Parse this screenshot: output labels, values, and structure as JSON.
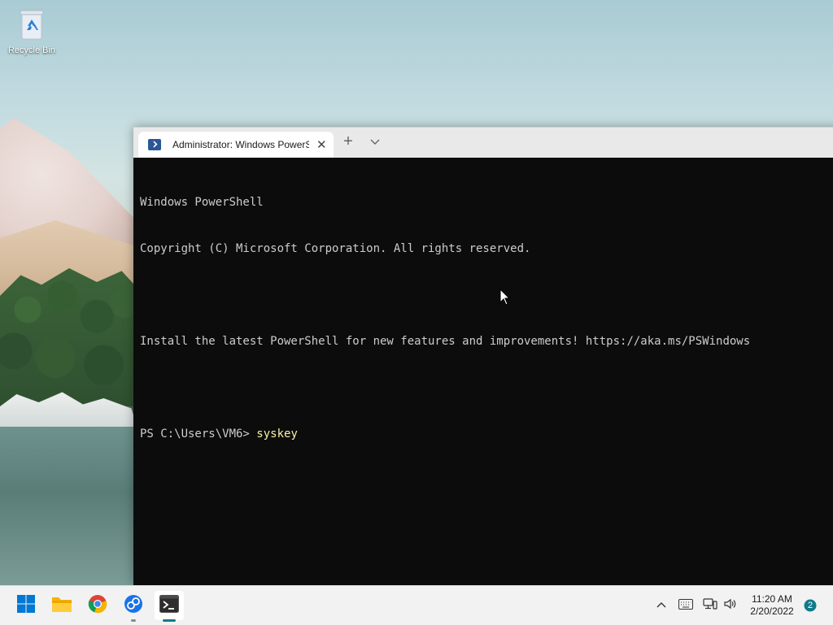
{
  "desktop": {
    "icons": [
      {
        "label": "Recycle Bin",
        "icon": "recycle-bin-icon"
      }
    ]
  },
  "terminal": {
    "tab_title": "Administrator: Windows PowerS",
    "tab_close": "✕",
    "new_tab": "+",
    "lines": [
      {
        "text": "Windows PowerShell",
        "cmd": ""
      },
      {
        "text": "Copyright (C) Microsoft Corporation. All rights reserved.",
        "cmd": ""
      },
      {
        "text": "",
        "cmd": ""
      },
      {
        "text": "Install the latest PowerShell for new features and improvements! https://aka.ms/PSWindows",
        "cmd": ""
      },
      {
        "text": "",
        "cmd": ""
      },
      {
        "text": "PS C:\\Users\\VM6> ",
        "cmd": "syskey"
      }
    ]
  },
  "taskbar": {
    "apps": [
      {
        "name": "start-button",
        "icon": "windows-logo-icon"
      },
      {
        "name": "file-explorer",
        "icon": "folder-icon"
      },
      {
        "name": "chrome",
        "icon": "chrome-icon"
      },
      {
        "name": "network-tool",
        "icon": "network-globe-icon"
      },
      {
        "name": "windows-terminal",
        "icon": "terminal-icon"
      }
    ],
    "clock": {
      "time": "11:20 AM",
      "date": "2/20/2022"
    },
    "notification_count": "2"
  },
  "colors": {
    "terminal_bg": "#0c0c0c",
    "terminal_text": "#cccccc",
    "command_text": "#f9f1a5",
    "accent": "#0f7b8a"
  }
}
